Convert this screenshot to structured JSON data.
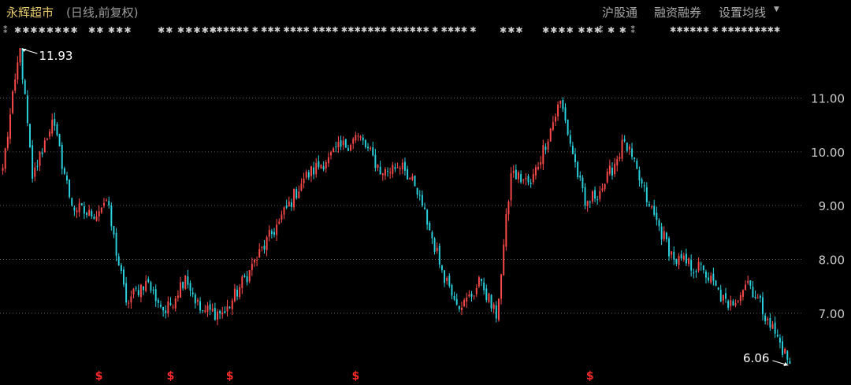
{
  "header": {
    "title": "永辉超市",
    "subtitle": "(日线,前复权)",
    "buttons": [
      "沪股通",
      "融资融券",
      "设置均线"
    ]
  },
  "ma_strip": {
    "groups": [
      "⁑",
      "✱✱✱✱✱✱✱✱",
      "✱✱ ✱✱✱",
      "✱✱ ✱✱✱✱✱",
      "✱✱✱✱✱✱ ✱ ✱✱✱ ✱✱✱✱ ✱✱✱✱ ✱✱✱✱✱✱✱ ✱✱✱✱✱✱ ✱ ✱✱✱✱ ✱",
      "✱✱✱",
      "✱✱✱✱ ✱✱✱",
      "⁑ ✱ ✱ ⁑",
      "✱✱✱✱✱✱ ✱ ✱✱✱✱✱✱✱✱✱"
    ]
  },
  "colors": {
    "up": "#ff4a4a",
    "down": "#2ad3e0",
    "grid": "#5a5a5a",
    "axis_text": "#c8c8c8",
    "marker": "#ff2a2a",
    "title": "#e7c96a"
  },
  "chart_data": {
    "type": "candlestick",
    "title": "永辉超市",
    "subtitle": "日线,前复权",
    "y_ticks": [
      7.0,
      8.0,
      9.0,
      10.0,
      11.0
    ],
    "y_tick_labels": [
      "7.00",
      "8.00",
      "9.00",
      "10.00",
      "11.00"
    ],
    "ylim": [
      6.0,
      12.0
    ],
    "grid": "horizontal dotted",
    "candle_count": 320,
    "max_annotation": {
      "value": 11.93,
      "label": "11.93"
    },
    "min_annotation": {
      "value": 6.06,
      "label": "6.06"
    },
    "close_path_keypoints": [
      {
        "i": 0,
        "v": 9.7
      },
      {
        "i": 7,
        "v": 11.93
      },
      {
        "i": 12,
        "v": 9.5
      },
      {
        "i": 20,
        "v": 10.6
      },
      {
        "i": 28,
        "v": 9.0
      },
      {
        "i": 36,
        "v": 8.8
      },
      {
        "i": 42,
        "v": 9.1
      },
      {
        "i": 50,
        "v": 7.2
      },
      {
        "i": 58,
        "v": 7.6
      },
      {
        "i": 66,
        "v": 7.0
      },
      {
        "i": 74,
        "v": 7.7
      },
      {
        "i": 80,
        "v": 7.05
      },
      {
        "i": 90,
        "v": 7.0
      },
      {
        "i": 100,
        "v": 7.8
      },
      {
        "i": 112,
        "v": 8.7
      },
      {
        "i": 122,
        "v": 9.5
      },
      {
        "i": 132,
        "v": 9.9
      },
      {
        "i": 144,
        "v": 10.3
      },
      {
        "i": 154,
        "v": 9.6
      },
      {
        "i": 162,
        "v": 9.8
      },
      {
        "i": 170,
        "v": 9.0
      },
      {
        "i": 178,
        "v": 7.8
      },
      {
        "i": 186,
        "v": 7.1
      },
      {
        "i": 194,
        "v": 7.6
      },
      {
        "i": 200,
        "v": 6.9
      },
      {
        "i": 206,
        "v": 9.6
      },
      {
        "i": 214,
        "v": 9.4
      },
      {
        "i": 226,
        "v": 10.95
      },
      {
        "i": 236,
        "v": 9.0
      },
      {
        "i": 244,
        "v": 9.4
      },
      {
        "i": 252,
        "v": 10.2
      },
      {
        "i": 262,
        "v": 9.0
      },
      {
        "i": 272,
        "v": 8.0
      },
      {
        "i": 284,
        "v": 7.8
      },
      {
        "i": 294,
        "v": 7.1
      },
      {
        "i": 302,
        "v": 7.6
      },
      {
        "i": 310,
        "v": 6.9
      },
      {
        "i": 319,
        "v": 6.06
      }
    ],
    "markers": {
      "label": "$",
      "candle_indices": [
        39,
        68,
        92,
        143,
        238
      ]
    }
  }
}
